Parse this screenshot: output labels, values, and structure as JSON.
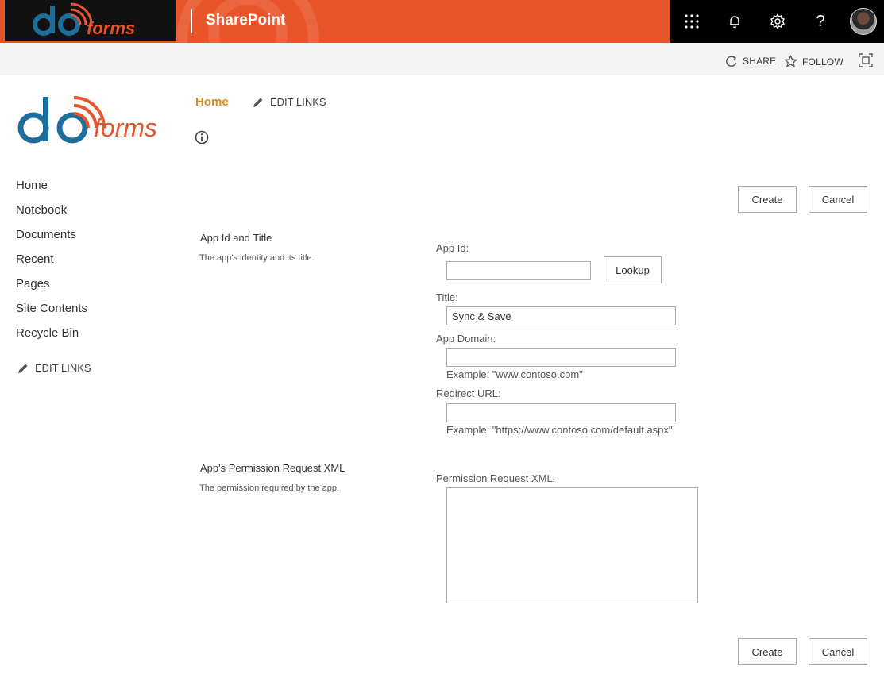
{
  "suite_bar": {
    "brand_logo": {
      "text_do": "do",
      "text_forms": "forms",
      "icon": "doforms-logo"
    },
    "app_title": "SharePoint",
    "icons": [
      "app-launcher-icon",
      "bell-icon",
      "gear-icon",
      "help-icon",
      "avatar"
    ],
    "help_label": "?"
  },
  "action_bar": {
    "share_label": "SHARE",
    "follow_label": "FOLLOW",
    "focus_icon": "focus-mode-icon"
  },
  "site_header": {
    "home_label": "Home",
    "edit_links_label": "EDIT LINKS"
  },
  "left_nav": {
    "items": [
      "Home",
      "Notebook",
      "Documents",
      "Recent",
      "Pages",
      "Site Contents",
      "Recycle Bin"
    ],
    "edit_links_label": "EDIT LINKS"
  },
  "buttons": {
    "create_label": "Create",
    "cancel_label": "Cancel",
    "lookup_label": "Lookup"
  },
  "form": {
    "section1": {
      "title": "App Id and Title",
      "description": "The app's identity and its title."
    },
    "app_id": {
      "label": "App Id:",
      "value": ""
    },
    "title": {
      "label": "Title:",
      "value": "Sync & Save"
    },
    "app_domain": {
      "label": "App Domain:",
      "value": "",
      "example": "Example: \"www.contoso.com\""
    },
    "redirect_url": {
      "label": "Redirect URL:",
      "value": "",
      "example": "Example: \"https://www.contoso.com/default.aspx\""
    },
    "section2": {
      "title": "App's Permission Request XML",
      "description": "The permission required by the app."
    },
    "permission_xml": {
      "label": "Permission Request XML:",
      "value": ""
    }
  },
  "colors": {
    "suite_bar_accent": "#e8552a",
    "logo_blue": "#1e6e9b",
    "logo_orange": "#e8552a",
    "home_link": "#d98b1a"
  }
}
